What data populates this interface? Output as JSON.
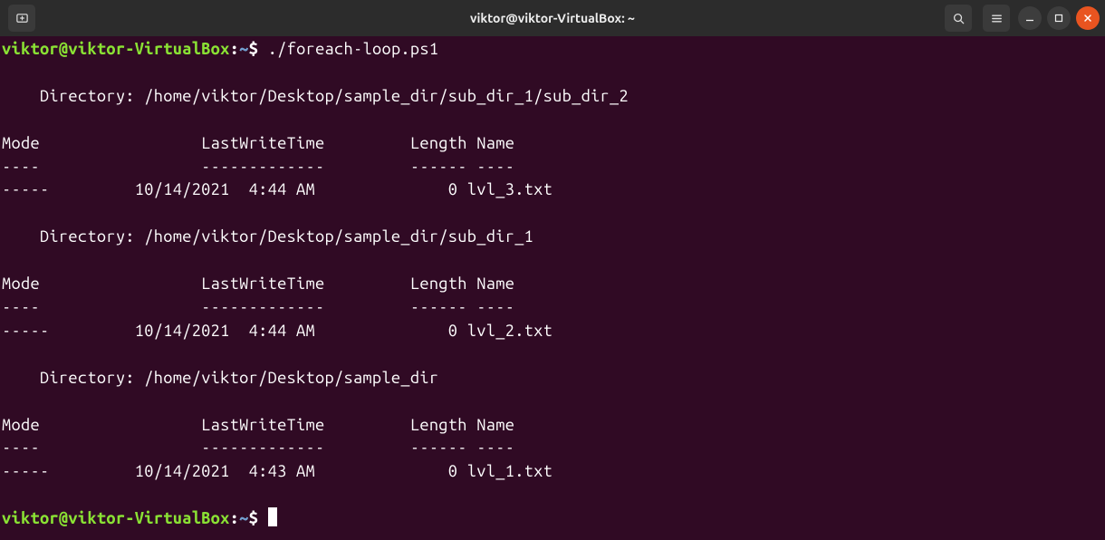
{
  "window": {
    "title": "viktor@viktor-VirtualBox: ~"
  },
  "prompt": {
    "userhost": "viktor@viktor-VirtualBox",
    "colon": ":",
    "path": "~",
    "dollar": "$"
  },
  "command": "./foreach-loop.ps1",
  "output": {
    "blank": "",
    "dirlabel": "    Directory: ",
    "dir1": "/home/viktor/Desktop/sample_dir/sub_dir_1/sub_dir_2",
    "dir2": "/home/viktor/Desktop/sample_dir/sub_dir_1",
    "dir3": "/home/viktor/Desktop/sample_dir",
    "header": "Mode                 LastWriteTime         Length Name",
    "divider": "----                 -------------         ------ ----",
    "row1": "-----         10/14/2021  4:44 AM              0 lvl_3.txt",
    "row2": "-----         10/14/2021  4:44 AM              0 lvl_2.txt",
    "row3": "-----         10/14/2021  4:43 AM              0 lvl_1.txt"
  }
}
